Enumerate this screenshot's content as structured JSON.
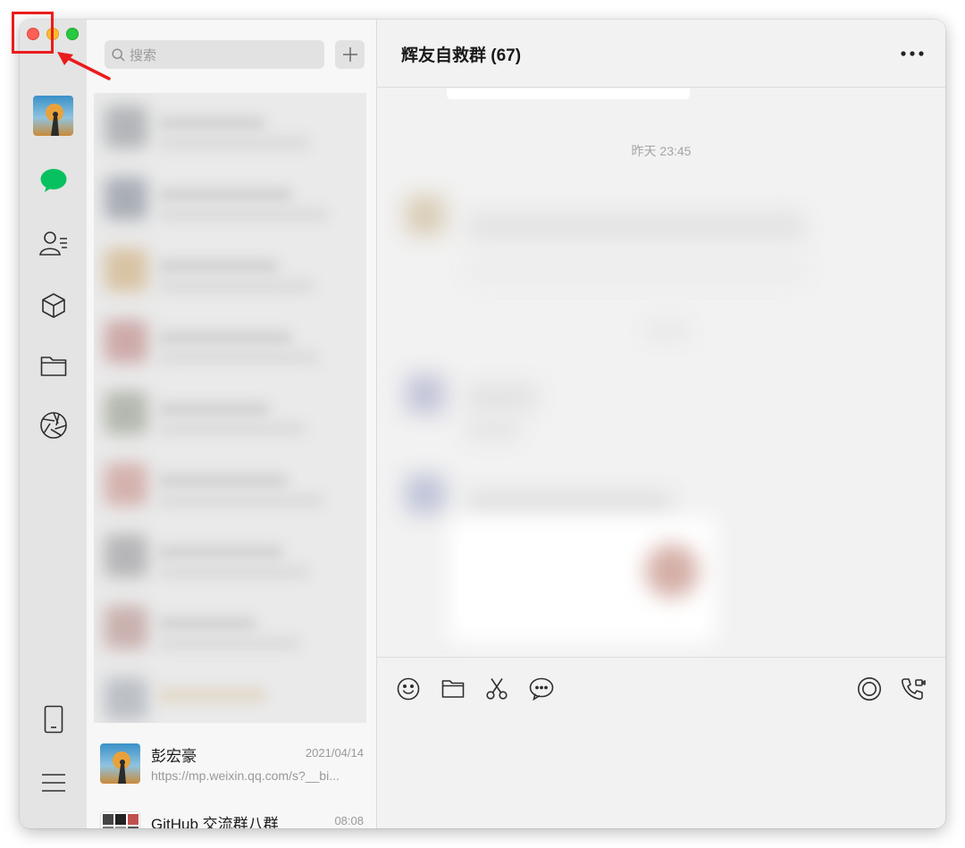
{
  "window": {
    "controls": [
      "close",
      "minimize",
      "zoom"
    ],
    "colors": {
      "close": "#fe5f57",
      "minimize": "#febc2e",
      "zoom": "#28c840",
      "accent": "#07c160",
      "annotation": "#ea1c1c"
    }
  },
  "sidebar": {
    "items": [
      {
        "name": "avatar"
      },
      {
        "name": "chat-icon",
        "active": true
      },
      {
        "name": "contacts-icon"
      },
      {
        "name": "favorites-cube-icon"
      },
      {
        "name": "folder-icon"
      },
      {
        "name": "moments-aperture-icon"
      },
      {
        "name": "phone-icon"
      },
      {
        "name": "menu-icon"
      }
    ]
  },
  "chatlist": {
    "search_placeholder": "搜索",
    "add_icon": "plus-icon",
    "items": [
      {
        "name": "彭宏豪",
        "time": "2021/04/14",
        "preview": "https://mp.weixin.qq.com/s?__bi..."
      },
      {
        "name": "GitHub 交流群八群",
        "time": "08:08",
        "preview": ""
      }
    ]
  },
  "chat": {
    "title": "辉友自救群 (67)",
    "timestamp": "昨天 23:45",
    "toolbar": {
      "left": [
        "emoji-icon",
        "folder-icon",
        "scissors-icon",
        "chat-bubble-icon"
      ],
      "right": [
        "live-icon",
        "call-icon"
      ]
    }
  }
}
